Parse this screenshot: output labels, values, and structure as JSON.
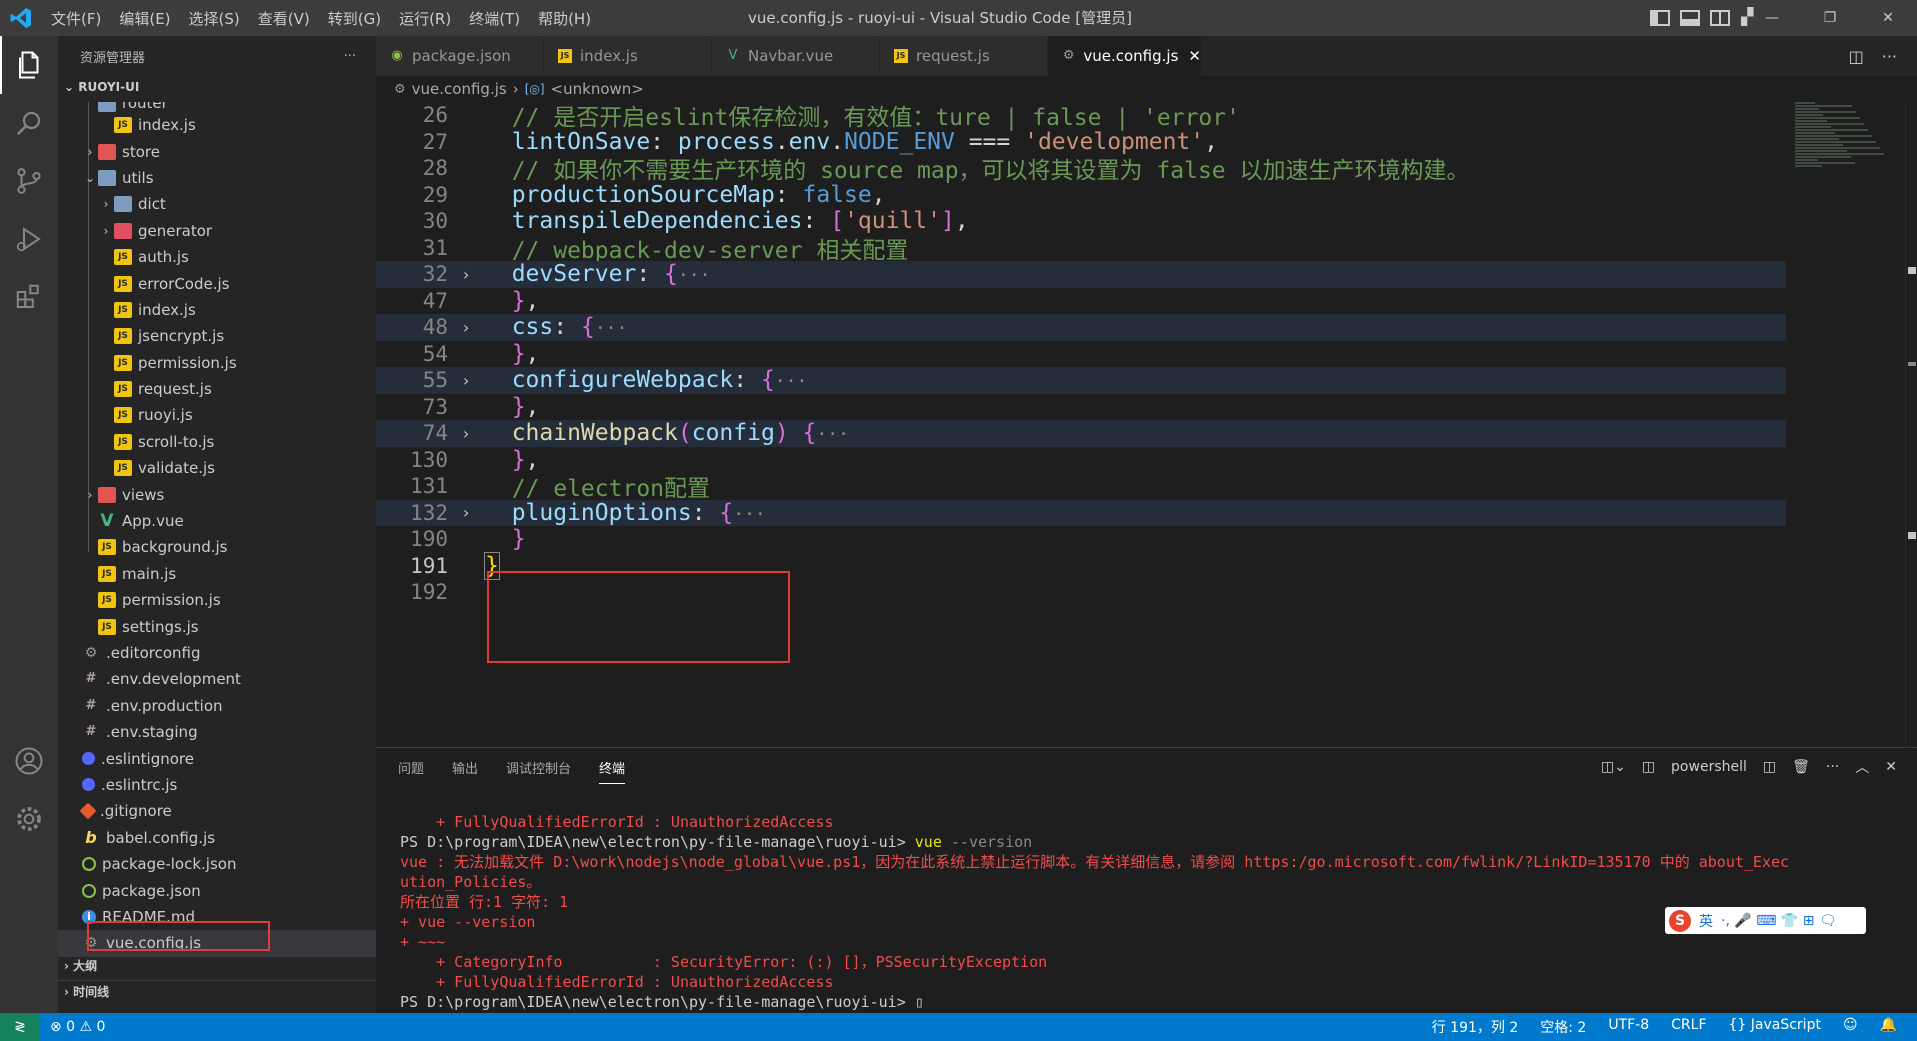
{
  "window": {
    "title": "vue.config.js - ruoyi-ui - Visual Studio Code [管理员]",
    "menu": [
      "文件(F)",
      "编辑(E)",
      "选择(S)",
      "查看(V)",
      "转到(G)",
      "运行(R)",
      "终端(T)",
      "帮助(H)"
    ]
  },
  "sidebar": {
    "title": "资源管理器",
    "more": "···",
    "root": "RUOYI-UI",
    "tree": [
      {
        "label": "router",
        "icon": "folder",
        "twisty": "",
        "indent": 1
      },
      {
        "label": "index.js",
        "icon": "js",
        "twisty": "",
        "indent": 2
      },
      {
        "label": "store",
        "icon": "folder-red",
        "twisty": "›",
        "indent": 1
      },
      {
        "label": "utils",
        "icon": "folder",
        "twisty": "⌄",
        "indent": 1
      },
      {
        "label": "dict",
        "icon": "folder",
        "twisty": "›",
        "indent": 2
      },
      {
        "label": "generator",
        "icon": "folder-gen",
        "twisty": "›",
        "indent": 2
      },
      {
        "label": "auth.js",
        "icon": "js",
        "twisty": "",
        "indent": 2
      },
      {
        "label": "errorCode.js",
        "icon": "js",
        "twisty": "",
        "indent": 2
      },
      {
        "label": "index.js",
        "icon": "js",
        "twisty": "",
        "indent": 2
      },
      {
        "label": "jsencrypt.js",
        "icon": "js",
        "twisty": "",
        "indent": 2
      },
      {
        "label": "permission.js",
        "icon": "js",
        "twisty": "",
        "indent": 2
      },
      {
        "label": "request.js",
        "icon": "js",
        "twisty": "",
        "indent": 2
      },
      {
        "label": "ruoyi.js",
        "icon": "js",
        "twisty": "",
        "indent": 2
      },
      {
        "label": "scroll-to.js",
        "icon": "js",
        "twisty": "",
        "indent": 2
      },
      {
        "label": "validate.js",
        "icon": "js",
        "twisty": "",
        "indent": 2
      },
      {
        "label": "views",
        "icon": "folder-red",
        "twisty": "›",
        "indent": 1
      },
      {
        "label": "App.vue",
        "icon": "vue",
        "twisty": "",
        "indent": 1
      },
      {
        "label": "background.js",
        "icon": "js",
        "twisty": "",
        "indent": 1
      },
      {
        "label": "main.js",
        "icon": "js",
        "twisty": "",
        "indent": 1
      },
      {
        "label": "permission.js",
        "icon": "js",
        "twisty": "",
        "indent": 1
      },
      {
        "label": "settings.js",
        "icon": "js",
        "twisty": "",
        "indent": 1
      },
      {
        "label": ".editorconfig",
        "icon": "cfg",
        "twisty": "",
        "indent": 0
      },
      {
        "label": ".env.development",
        "icon": "env",
        "twisty": "",
        "indent": 0
      },
      {
        "label": ".env.production",
        "icon": "env",
        "twisty": "",
        "indent": 0
      },
      {
        "label": ".env.staging",
        "icon": "env",
        "twisty": "",
        "indent": 0
      },
      {
        "label": ".eslintignore",
        "icon": "eslint",
        "twisty": "",
        "indent": 0
      },
      {
        "label": ".eslintrc.js",
        "icon": "eslint",
        "twisty": "",
        "indent": 0
      },
      {
        "label": ".gitignore",
        "icon": "git",
        "twisty": "",
        "indent": 0
      },
      {
        "label": "babel.config.js",
        "icon": "babel",
        "twisty": "",
        "indent": 0
      },
      {
        "label": "package-lock.json",
        "icon": "json",
        "twisty": "",
        "indent": 0
      },
      {
        "label": "package.json",
        "icon": "json",
        "twisty": "",
        "indent": 0
      },
      {
        "label": "README.md",
        "icon": "info",
        "twisty": "",
        "indent": 0
      },
      {
        "label": "vue.config.js",
        "icon": "cfg",
        "twisty": "",
        "indent": 0,
        "selected": true
      }
    ],
    "outline": "大纲",
    "timeline": "时间线"
  },
  "tabs": [
    {
      "label": "package.json",
      "icon": "json",
      "active": false
    },
    {
      "label": "index.js",
      "icon": "js",
      "active": false
    },
    {
      "label": "Navbar.vue",
      "icon": "vue",
      "active": false
    },
    {
      "label": "request.js",
      "icon": "js",
      "active": false
    },
    {
      "label": "vue.config.js",
      "icon": "cfg",
      "active": true
    }
  ],
  "breadcrumb": {
    "file": "vue.config.js",
    "sep": "›",
    "symbol": "<unknown>"
  },
  "editor": {
    "lines": [
      {
        "n": "26",
        "fold": "",
        "folded": false,
        "cur": false,
        "tokens": [
          [
            "c-com",
            "  // 是否开启eslint保存检测，有效值：ture | false | 'error'"
          ]
        ]
      },
      {
        "n": "27",
        "fold": "",
        "folded": false,
        "cur": false,
        "tokens": [
          [
            "c-var",
            "  lintOnSave"
          ],
          [
            "c-op",
            ": "
          ],
          [
            "c-var",
            "process"
          ],
          [
            "c-op",
            "."
          ],
          [
            "c-var",
            "env"
          ],
          [
            "c-op",
            "."
          ],
          [
            "c-kw",
            "NODE_ENV"
          ],
          [
            "c-op",
            " === "
          ],
          [
            "c-str",
            "'development'"
          ],
          [
            "c-op",
            ","
          ]
        ]
      },
      {
        "n": "28",
        "fold": "",
        "folded": false,
        "cur": false,
        "tokens": [
          [
            "c-com",
            "  // 如果你不需要生产环境的 source map，可以将其设置为 false 以加速生产环境构建。"
          ]
        ]
      },
      {
        "n": "29",
        "fold": "",
        "folded": false,
        "cur": false,
        "tokens": [
          [
            "c-var",
            "  productionSourceMap"
          ],
          [
            "c-op",
            ": "
          ],
          [
            "c-kw",
            "false"
          ],
          [
            "c-op",
            ","
          ]
        ]
      },
      {
        "n": "30",
        "fold": "",
        "folded": false,
        "cur": false,
        "tokens": [
          [
            "c-var",
            "  transpileDependencies"
          ],
          [
            "c-op",
            ": "
          ],
          [
            "c-brace",
            "["
          ],
          [
            "c-str",
            "'quill'"
          ],
          [
            "c-brace",
            "]"
          ],
          [
            "c-op",
            ","
          ]
        ]
      },
      {
        "n": "31",
        "fold": "",
        "folded": false,
        "cur": false,
        "tokens": [
          [
            "c-com",
            "  // webpack-dev-server 相关配置"
          ]
        ]
      },
      {
        "n": "32",
        "fold": "›",
        "folded": true,
        "cur": false,
        "tokens": [
          [
            "c-var",
            "  devServer"
          ],
          [
            "c-op",
            ": "
          ],
          [
            "c-brace",
            "{"
          ],
          [
            "c-ellip",
            "···"
          ]
        ]
      },
      {
        "n": "47",
        "fold": "",
        "folded": false,
        "cur": false,
        "tokens": [
          [
            "c-brace",
            "  }"
          ],
          [
            "c-op",
            ","
          ]
        ]
      },
      {
        "n": "48",
        "fold": "›",
        "folded": true,
        "cur": false,
        "tokens": [
          [
            "c-var",
            "  css"
          ],
          [
            "c-op",
            ": "
          ],
          [
            "c-brace",
            "{"
          ],
          [
            "c-ellip",
            "···"
          ]
        ]
      },
      {
        "n": "54",
        "fold": "",
        "folded": false,
        "cur": false,
        "tokens": [
          [
            "c-brace",
            "  }"
          ],
          [
            "c-op",
            ","
          ]
        ]
      },
      {
        "n": "55",
        "fold": "›",
        "folded": true,
        "cur": false,
        "tokens": [
          [
            "c-var",
            "  configureWebpack"
          ],
          [
            "c-op",
            ": "
          ],
          [
            "c-brace",
            "{"
          ],
          [
            "c-ellip",
            "···"
          ]
        ]
      },
      {
        "n": "73",
        "fold": "",
        "folded": false,
        "cur": false,
        "tokens": [
          [
            "c-brace",
            "  }"
          ],
          [
            "c-op",
            ","
          ]
        ]
      },
      {
        "n": "74",
        "fold": "›",
        "folded": true,
        "cur": false,
        "tokens": [
          [
            "c-fn",
            "  chainWebpack"
          ],
          [
            "c-paren",
            "("
          ],
          [
            "c-var",
            "config"
          ],
          [
            "c-paren",
            ")"
          ],
          [
            "c-op",
            " "
          ],
          [
            "c-brace",
            "{"
          ],
          [
            "c-ellip",
            "···"
          ]
        ]
      },
      {
        "n": "130",
        "fold": "",
        "folded": false,
        "cur": false,
        "tokens": [
          [
            "c-brace",
            "  }"
          ],
          [
            "c-op",
            ","
          ]
        ]
      },
      {
        "n": "131",
        "fold": "",
        "folded": false,
        "cur": false,
        "tokens": [
          [
            "c-com",
            "  // electron配置"
          ]
        ]
      },
      {
        "n": "132",
        "fold": "›",
        "folded": true,
        "cur": false,
        "tokens": [
          [
            "c-var",
            "  pluginOptions"
          ],
          [
            "c-op",
            ": "
          ],
          [
            "c-brace",
            "{"
          ],
          [
            "c-ellip",
            "···"
          ]
        ]
      },
      {
        "n": "190",
        "fold": "",
        "folded": false,
        "cur": false,
        "tokens": [
          [
            "c-brace",
            "  }"
          ]
        ]
      },
      {
        "n": "191",
        "fold": "",
        "folded": false,
        "cur": true,
        "tokens": [
          [
            "c-yb",
            "}"
          ]
        ]
      },
      {
        "n": "192",
        "fold": "",
        "folded": false,
        "cur": false,
        "tokens": []
      }
    ]
  },
  "panel": {
    "tabs": [
      "问题",
      "输出",
      "调试控制台",
      "终端"
    ],
    "active_tab": "终端",
    "shell": "powershell",
    "terminal": [
      {
        "cls": "t-err",
        "text": "    + FullyQualifiedErrorId : UnauthorizedAccess"
      },
      {
        "cls": "t-norm",
        "text": "PS D:\\program\\IDEA\\new\\electron\\py-file-manage\\ruoyi-ui> ",
        "cmd": "vue",
        "rest": " --version"
      },
      {
        "cls": "t-err",
        "text": "vue : 无法加载文件 D:\\work\\nodejs\\node_global\\vue.ps1，因为在此系统上禁止运行脚本。有关详细信息，请参阅 https:/go.microsoft.com/fwlink/?LinkID=135170 中的 about_Exec"
      },
      {
        "cls": "t-err",
        "text": "ution_Policies。"
      },
      {
        "cls": "t-err",
        "text": "所在位置 行:1 字符: 1"
      },
      {
        "cls": "t-err",
        "text": "+ vue --version"
      },
      {
        "cls": "t-err",
        "text": "+ ~~~"
      },
      {
        "cls": "t-err",
        "text": "    + CategoryInfo          : SecurityError: (:) []，PSSecurityException"
      },
      {
        "cls": "t-err",
        "text": "    + FullyQualifiedErrorId : UnauthorizedAccess"
      },
      {
        "cls": "t-norm",
        "text": "PS D:\\program\\IDEA\\new\\electron\\py-file-manage\\ruoyi-ui> ",
        "cursor": "▯"
      }
    ]
  },
  "ime": {
    "logo": "S",
    "lang": "英",
    "icons": "·, 🎤 ⌨ 👕 ⊞ 🗨"
  },
  "status": {
    "errors": "⊗ 0 ⚠ 0",
    "position": "行 191，列 2",
    "spaces": "空格: 2",
    "encoding": "UTF-8",
    "eol": "CRLF",
    "language": "{} JavaScript"
  }
}
